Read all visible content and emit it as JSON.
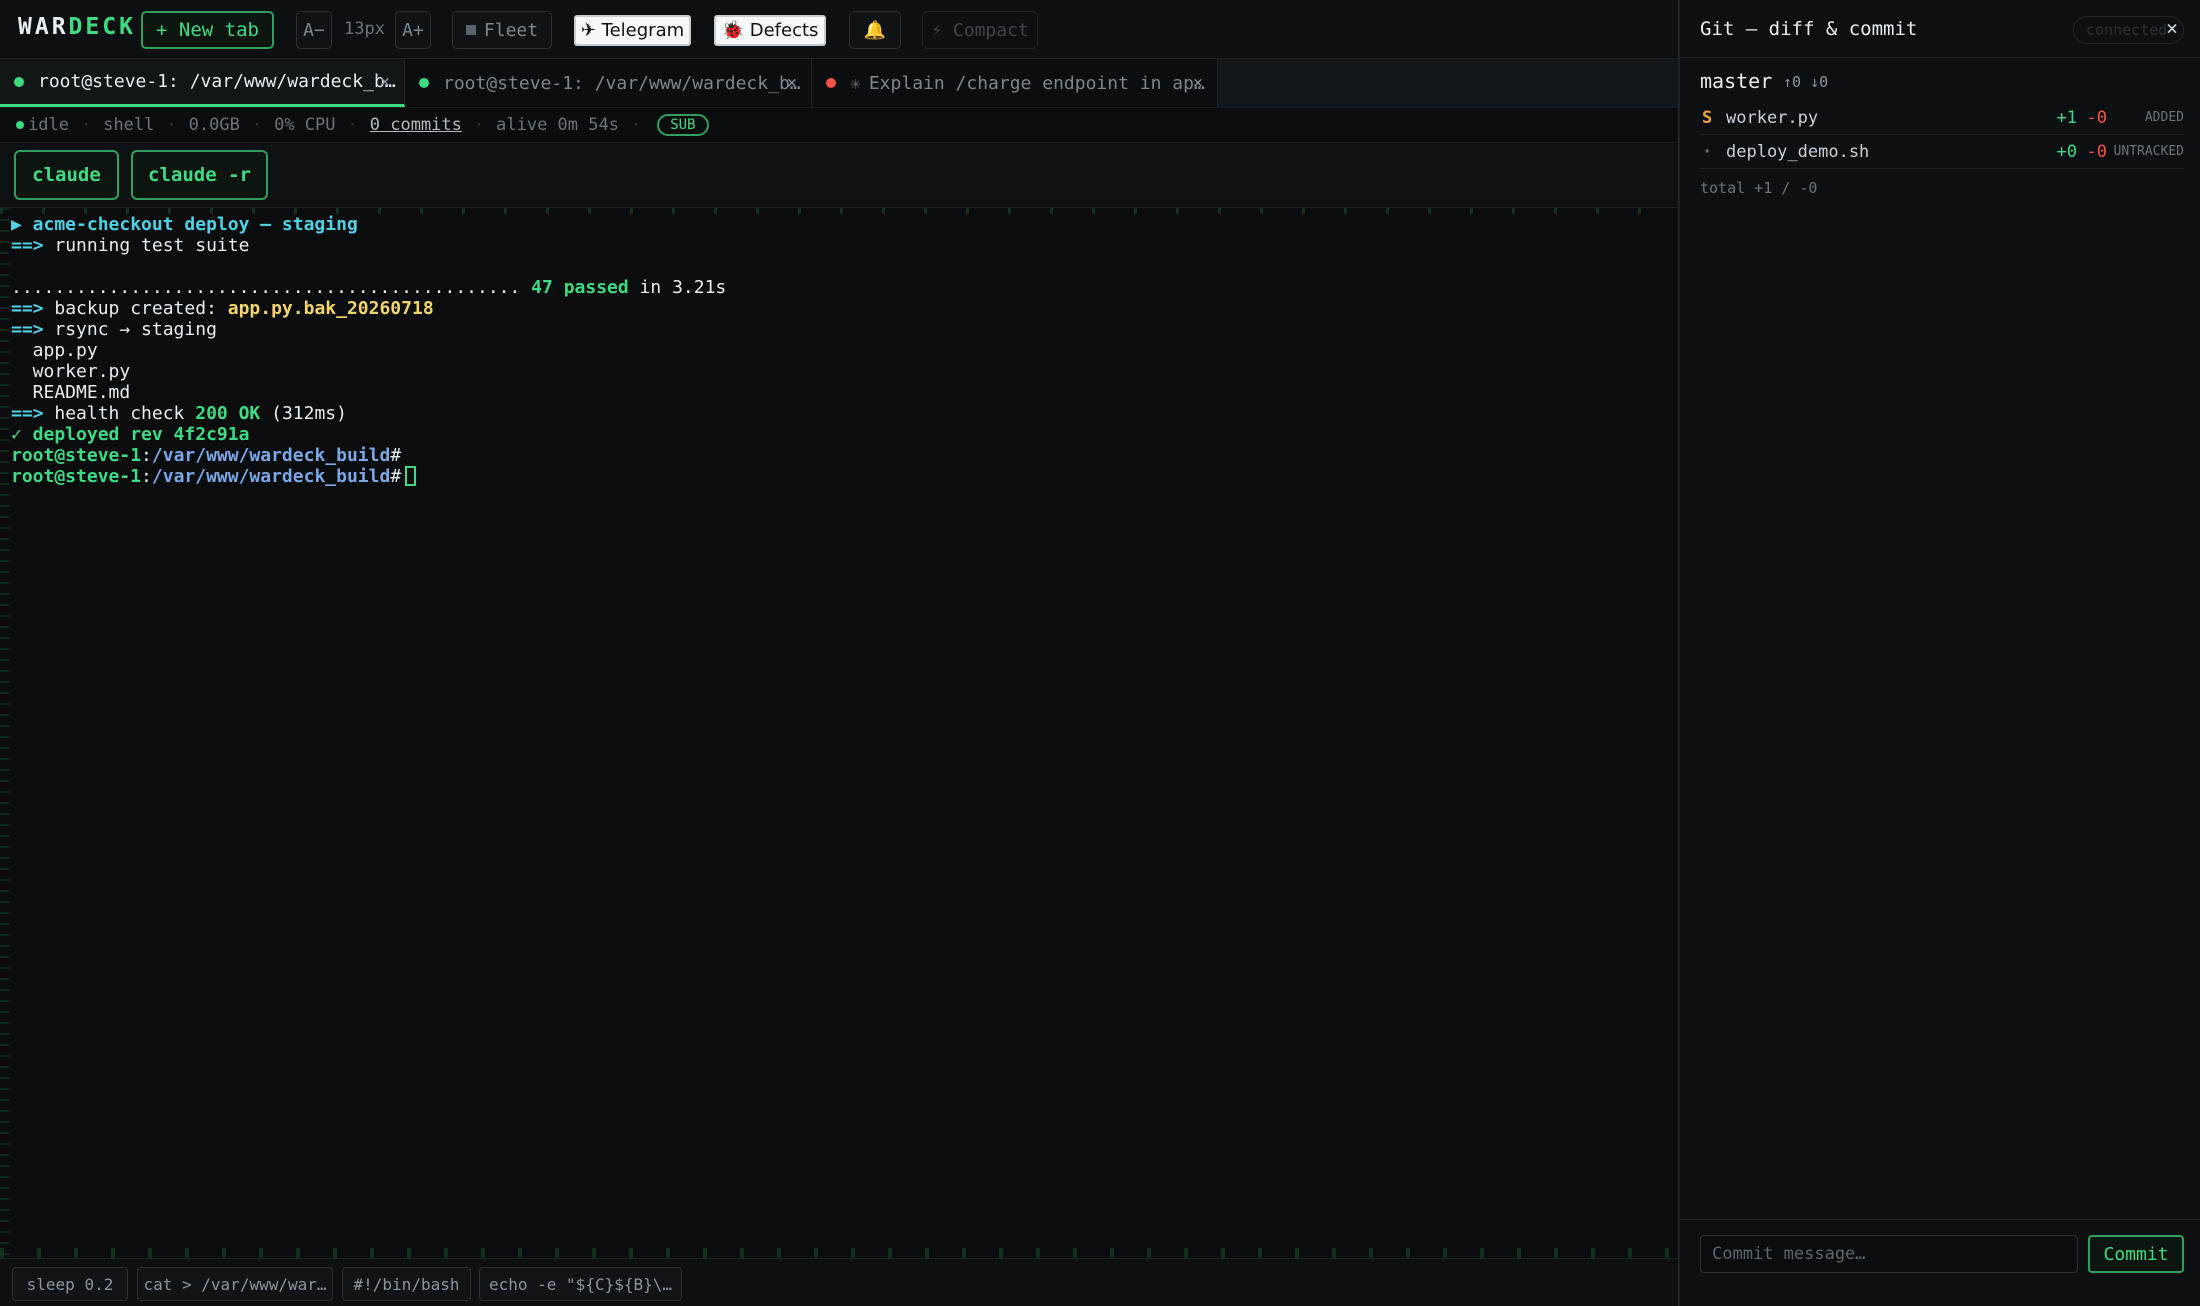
{
  "toolbar": {
    "logo_prefix": "WAR",
    "logo_suffix": "DECK",
    "new_tab": "+ New tab",
    "font_decrease": "A−",
    "font_size": "13px",
    "font_increase": "A+",
    "fleet": "Fleet",
    "telegram": "✈ Telegram",
    "defects": "🐞 Defects",
    "bell": "🔔",
    "compact": "⚡ Compact"
  },
  "tabs": [
    {
      "title": "root@steve-1: /var/www/wardeck_b…",
      "status_color": "#3ddc84",
      "close": "×"
    },
    {
      "title": "root@steve-1: /var/www/wardeck_b…",
      "status_color": "#3ddc84",
      "close": "×"
    },
    {
      "title": "Explain /charge endpoint in ap…",
      "status_color": "#f85149",
      "prefix": "✳",
      "close": "×"
    }
  ],
  "status": {
    "state": "idle",
    "kind": "shell",
    "memory": "0.0GB",
    "cpu": "0% CPU",
    "commits": "0 commits",
    "alive": "alive 0m 54s",
    "badge": "SUB"
  },
  "quick": {
    "claude": "claude",
    "claude_resume": "claude -r"
  },
  "terminal": {
    "line1": "▶ acme-checkout deploy — staging",
    "arrow": "==>",
    "line2": " running test suite",
    "dots": "...............................................",
    "passed": " 47 passed",
    "passed_tail": " in 3.21s",
    "backup_label": " backup created: ",
    "backup_file": "app.py.bak_20260718",
    "rsync": " rsync → staging",
    "file1": "  app.py",
    "file2": "  worker.py",
    "file3": "  README.md",
    "health_label": " health check ",
    "health_ok": "200 OK",
    "health_tail": " (312ms)",
    "deployed": "✓ deployed rev 4f2c91a",
    "prompt_user": "root@steve-1",
    "prompt_colon": ":",
    "prompt_path": "/var/www/wardeck_build",
    "prompt_hash": "#"
  },
  "history": [
    "sleep 0.2",
    "cat > /var/www/war…",
    "#!/bin/bash",
    "echo -e \"${C}${B}\\…"
  ],
  "git": {
    "title": "Git — diff & commit",
    "connection": "connected",
    "close": "×",
    "branch": "master",
    "ahead_behind": "↑0 ↓0",
    "files": [
      {
        "status": "S",
        "status_color": "#f2a33a",
        "name": "worker.py",
        "plus": "+1",
        "minus": "-0",
        "tag": "ADDED"
      },
      {
        "status": "·",
        "status_color": "#6b747c",
        "name": "deploy_demo.sh",
        "plus": "+0",
        "minus": "-0",
        "tag": "UNTRACKED"
      }
    ],
    "total": "total +1 / -0",
    "commit_placeholder": "Commit message…",
    "commit_button": "Commit"
  }
}
